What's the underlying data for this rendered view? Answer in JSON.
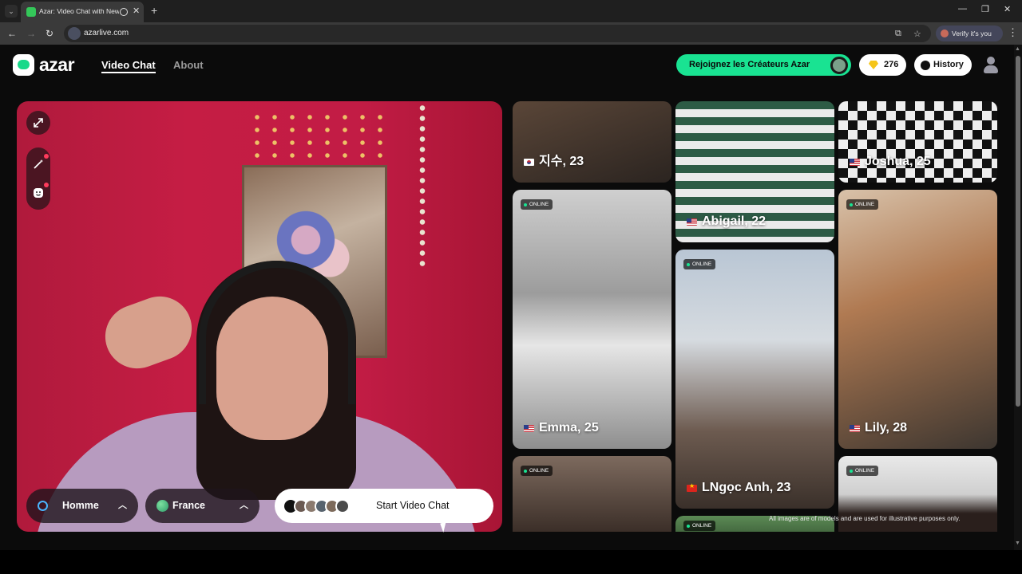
{
  "browser": {
    "tab_title": "Azar: Video Chat with New",
    "url": "azarlive.com",
    "verify_label": "Verify it's you",
    "icons": [
      "tab-list-icon",
      "record-icon",
      "close-icon",
      "plus-icon",
      "minimize-icon",
      "maximize-icon",
      "back-icon",
      "forward-icon",
      "reload-icon",
      "site-info-icon",
      "cast-icon",
      "star-icon",
      "menu-icon"
    ]
  },
  "header": {
    "logo": "azar",
    "nav": [
      {
        "label": "Video Chat",
        "active": true
      },
      {
        "label": "About",
        "active": false
      }
    ],
    "creator_label": "Rejoignez les Créateurs Azar",
    "gems": "276",
    "history_label": "History"
  },
  "video": {
    "gender_label": "Homme",
    "country_label": "France",
    "start_label": "Start Video Chat"
  },
  "cards": [
    {
      "name": "지수, 23",
      "flag": "kr",
      "online": false
    },
    {
      "name": "Abigail, 22",
      "flag": "us",
      "online": false
    },
    {
      "name": "Joshua, 25",
      "flag": "us",
      "online": false
    },
    {
      "name": "Emma, 25",
      "flag": "us",
      "online": true
    },
    {
      "name": "LNgọc Anh, 23",
      "flag": "vn",
      "online": true
    },
    {
      "name": "Lily, 28",
      "flag": "us",
      "online": true
    },
    {
      "name": "",
      "flag": "",
      "online": true
    },
    {
      "name": "",
      "flag": "",
      "online": true
    },
    {
      "name": "",
      "flag": "",
      "online": true
    }
  ],
  "online_label": "ONLINE",
  "disclaimer": "All images are of models and are used for illustrative purposes only.",
  "colors": {
    "accent_green": "#19e392",
    "video_bg": "#c21c45",
    "page_bg": "#0b0b0b"
  }
}
